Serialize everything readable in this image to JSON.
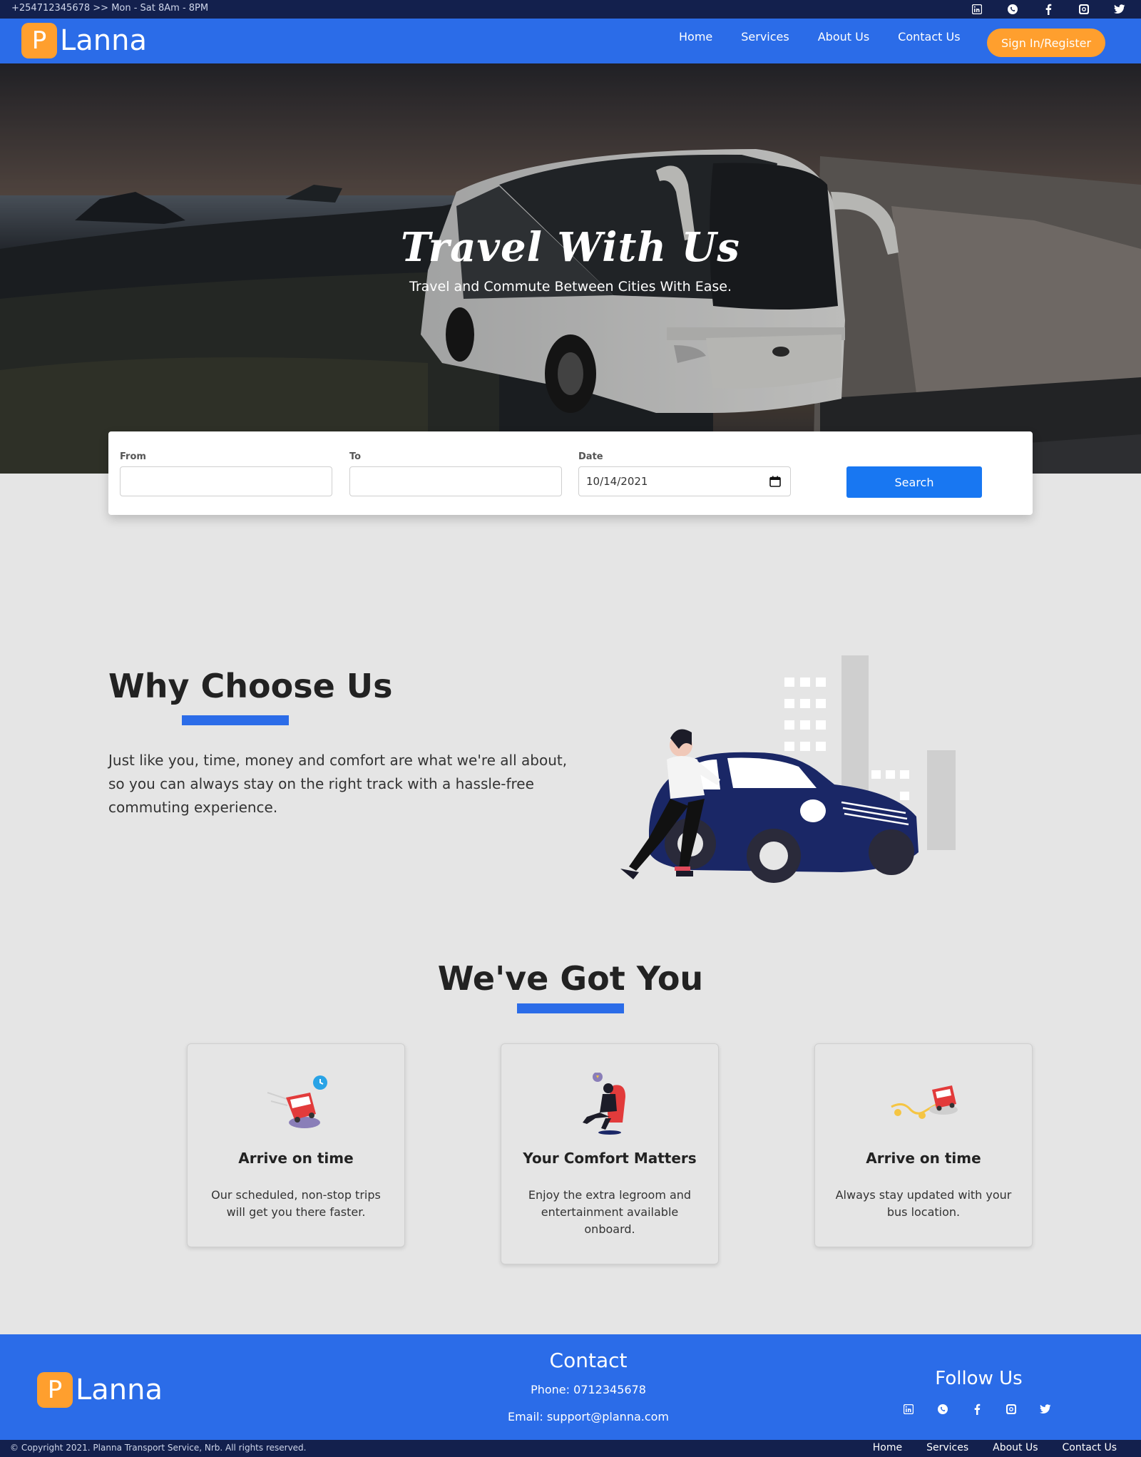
{
  "topbar": {
    "info": "+254712345678 >> Mon - Sat 8Am - 8PM",
    "socials": [
      "linkedin-icon",
      "whatsapp-icon",
      "facebook-icon",
      "instagram-icon",
      "twitter-icon"
    ]
  },
  "brand": {
    "letter": "P",
    "name": "Lanna",
    "accent": "#ff9f2e",
    "primary": "#2b6ce8",
    "dark": "#13204d"
  },
  "nav": {
    "links": [
      "Home",
      "Services",
      "About Us",
      "Contact Us"
    ],
    "signin_label": "Sign In/Register"
  },
  "hero": {
    "title": "Travel With Us",
    "subtitle": "Travel and Commute Between Cities With Ease."
  },
  "search": {
    "from_label": "From",
    "from_value": "",
    "to_label": "To",
    "to_value": "",
    "date_label": "Date",
    "date_value": "10/14/2021",
    "button_label": "Search"
  },
  "why": {
    "title": "Why Choose Us",
    "text": "Just like you, time, money and comfort are what we're all about, so you can always stay on the right track with a hassle-free commuting experience."
  },
  "got": {
    "title": "We've Got You",
    "cards": [
      {
        "icon": "bus-clock-icon",
        "title": "Arrive on time",
        "text": "Our scheduled, non-stop trips will get you there faster."
      },
      {
        "icon": "comfort-seat-icon",
        "title": "Your Comfort Matters",
        "text": "Enjoy the extra legroom and entertainment available onboard."
      },
      {
        "icon": "bus-location-icon",
        "title": "Arrive on time",
        "text": "Always stay updated with your bus location."
      }
    ]
  },
  "footer": {
    "contact_title": "Contact",
    "phone": "Phone: 0712345678",
    "email": "Email: support@planna.com",
    "follow_title": "Follow Us",
    "copyright": "© Copyright 2021. Planna Transport Service, Nrb. All rights reserved.",
    "links": [
      "Home",
      "Services",
      "About Us",
      "Contact Us"
    ]
  }
}
